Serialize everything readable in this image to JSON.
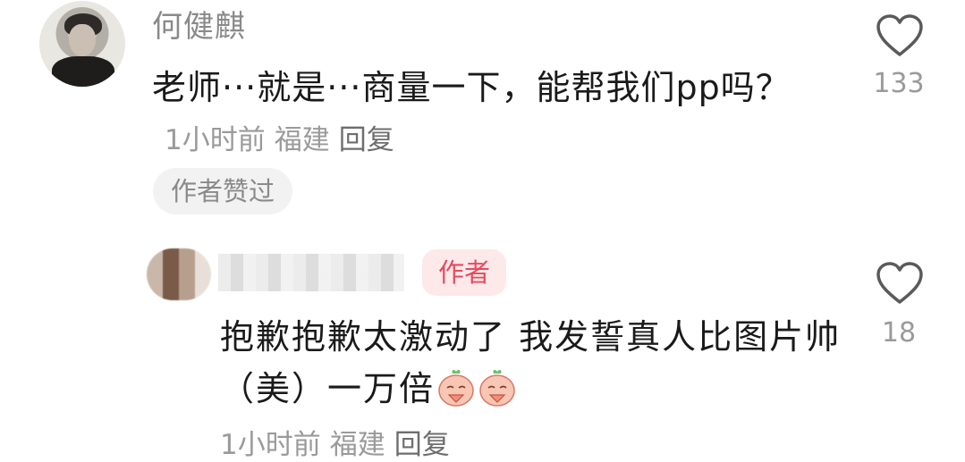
{
  "comments": [
    {
      "username": "何健麒",
      "text": "老师···就是···商量一下，能帮我们pp吗？",
      "time": "1小时前",
      "location": "福建",
      "reply_label": "回复",
      "badge": "作者赞过",
      "like_count": "133",
      "icons": [
        "avatar",
        "heart-outline-icon"
      ]
    },
    {
      "author_badge": "作者",
      "text": "抱歉抱歉太激动了 我发誓真人比图片帅（美）一万倍",
      "time": "1小时前",
      "location": "福建",
      "reply_label": "回复",
      "like_count": "18",
      "icons": [
        "blurred-avatar",
        "heart-outline-icon",
        "praying-face-emoji"
      ]
    }
  ],
  "colors": {
    "author_badge_bg": "#fde8ea",
    "author_badge_text": "#e8495c",
    "meta_text": "#9a9a9a",
    "body_text": "#1a1a1a"
  }
}
